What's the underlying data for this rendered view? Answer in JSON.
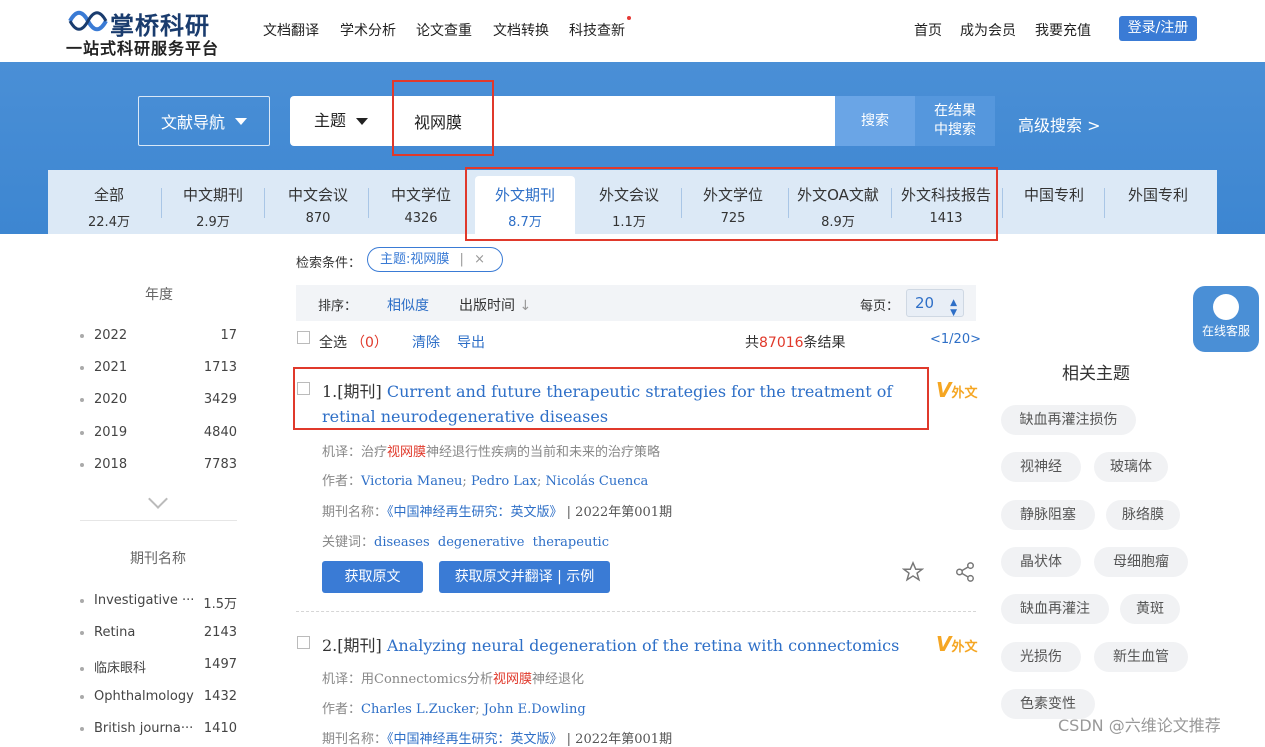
{
  "header": {
    "logo_name": "掌桥科研",
    "logo_sub": "一站式科研服务平台",
    "nav": [
      "文档翻译",
      "学术分析",
      "论文查重",
      "文档转换",
      "科技查新"
    ],
    "right_nav": [
      "首页",
      "成为会员",
      "我要充值"
    ],
    "login": "登录/注册"
  },
  "search": {
    "nav_button": "文献导航",
    "field": "主题",
    "query": "视网膜",
    "search_button": "搜索",
    "in_result_line1": "在结果",
    "in_result_line2": "中搜索",
    "advanced": "高级搜索 >"
  },
  "tabs": [
    {
      "label": "全部",
      "count": "22.4万"
    },
    {
      "label": "中文期刊",
      "count": "2.9万"
    },
    {
      "label": "中文会议",
      "count": "870"
    },
    {
      "label": "中文学位",
      "count": "4326"
    },
    {
      "label": "外文期刊",
      "count": "8.7万"
    },
    {
      "label": "外文会议",
      "count": "1.1万"
    },
    {
      "label": "外文学位",
      "count": "725"
    },
    {
      "label": "外文OA文献",
      "count": "8.9万"
    },
    {
      "label": "外文科技报告",
      "count": "1413"
    },
    {
      "label": "中国专利",
      "count": ""
    },
    {
      "label": "外国专利",
      "count": ""
    }
  ],
  "left": {
    "year_title": "年度",
    "years": [
      {
        "label": "2022",
        "count": "17"
      },
      {
        "label": "2021",
        "count": "1713"
      },
      {
        "label": "2020",
        "count": "3429"
      },
      {
        "label": "2019",
        "count": "4840"
      },
      {
        "label": "2018",
        "count": "7783"
      }
    ],
    "journal_title": "期刊名称",
    "journals": [
      {
        "label": "Investigative ···",
        "count": "1.5万"
      },
      {
        "label": "Retina",
        "count": "2143"
      },
      {
        "label": "临床眼科",
        "count": "1497"
      },
      {
        "label": "Ophthalmology",
        "count": "1432"
      },
      {
        "label": "British journa···",
        "count": "1410"
      }
    ]
  },
  "filters": {
    "label": "检索条件：",
    "tag": "主题:视网膜",
    "tag_sep": "|",
    "tag_close": "×"
  },
  "sort": {
    "label": "排序：",
    "relevance": "相似度",
    "date": "出版时间",
    "per_page_label": "每页：",
    "per_page": "20"
  },
  "toolbar": {
    "select_all": "全选",
    "selected_count": "（0）",
    "clear": "清除",
    "export": "导出",
    "total_prefix": "共",
    "total": "87016",
    "total_suffix": "条结果",
    "page_current": "<1",
    "page_rest": "/20>"
  },
  "results": [
    {
      "index": "1.[期刊]",
      "title": "Current and future therapeutic strategies for the treatment of retinal neurodegenerative diseases",
      "mt_label": "机译：",
      "mt_before": "治疗",
      "mt_highlight": "视网膜",
      "mt_after": "神经退行性疾病的当前和未来的治疗策略",
      "authors_label": "作者：",
      "authors": [
        "Victoria Maneu",
        "Pedro Lax",
        "Nicolás Cuenca"
      ],
      "journal_label": "期刊名称：",
      "journal": "《中国神经再生研究：英文版》",
      "issue": "| 2022年第001期",
      "keywords_label": "关键词：",
      "keywords": [
        "diseases",
        "degenerative",
        "therapeutic"
      ],
      "badge": "外文",
      "btn_get": "获取原文",
      "btn_translate": "获取原文并翻译 | 示例"
    },
    {
      "index": "2.[期刊]",
      "title": "Analyzing neural degeneration of the retina with connectomics",
      "mt_label": "机译：",
      "mt_before": "用Connectomics分析",
      "mt_highlight": "视网膜",
      "mt_after": "神经退化",
      "authors_label": "作者：",
      "authors": [
        "Charles L.Zucker",
        "John E.Dowling"
      ],
      "journal_label": "期刊名称：",
      "journal": "《中国神经再生研究：英文版》",
      "issue": "| 2022年第001期",
      "badge": "外文"
    }
  ],
  "topics": {
    "title": "相关主题",
    "items": [
      "缺血再灌注损伤",
      "视神经",
      "玻璃体",
      "静脉阻塞",
      "脉络膜",
      "晶状体",
      "母细胞瘤",
      "缺血再灌注",
      "黄斑",
      "光损伤",
      "新生血管",
      "色素变性"
    ]
  },
  "service": "在线客服",
  "watermark": "CSDN @六维论文推荐",
  "colors": {
    "accent": "#3a7bd5",
    "hero": "#4a8fd6",
    "highlight": "#e0392b",
    "annotation": "#e0392b"
  }
}
